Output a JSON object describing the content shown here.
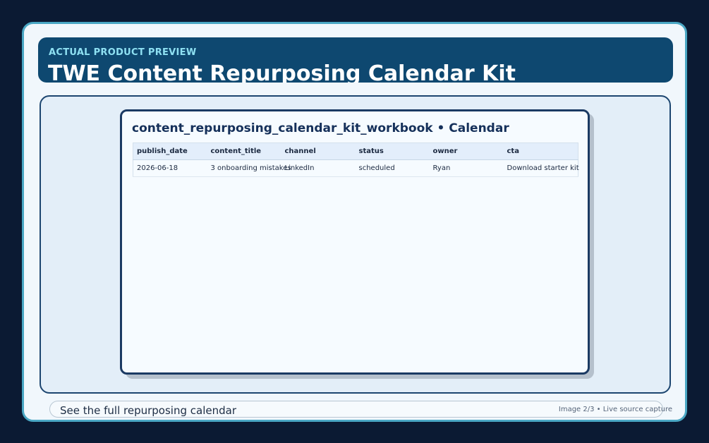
{
  "header": {
    "eyebrow": "ACTUAL PRODUCT PREVIEW",
    "title": "TWE Content Repurposing Calendar Kit"
  },
  "sheet": {
    "title": "content_repurposing_calendar_kit_workbook • Calendar",
    "columns": [
      "publish_date",
      "content_title",
      "channel",
      "status",
      "owner",
      "cta"
    ],
    "rows": [
      [
        "2026-06-18",
        "3 onboarding mistakes",
        "LinkedIn",
        "scheduled",
        "Ryan",
        "Download starter kit"
      ]
    ]
  },
  "footer": {
    "cta": "See the full repurposing calendar",
    "caption": "Image 2/3 • Live source capture"
  }
}
